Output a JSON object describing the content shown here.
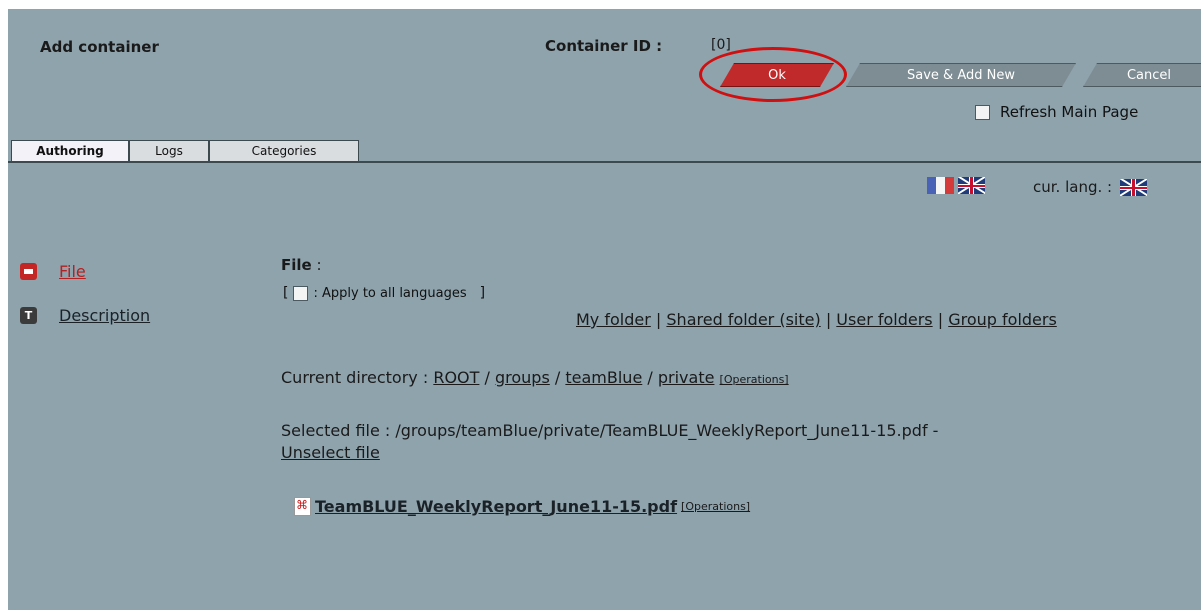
{
  "header": {
    "title": "Add container",
    "container_id_label": "Container ID :",
    "container_id_value": "[0]"
  },
  "buttons": {
    "ok": "Ok",
    "save_add_new": "Save & Add New",
    "cancel": "Cancel"
  },
  "refresh_label": "Refresh Main Page",
  "tabs": [
    {
      "label": "Authoring"
    },
    {
      "label": "Logs"
    },
    {
      "label": "Categories"
    }
  ],
  "lang": {
    "current_label": "cur. lang. :",
    "flags": [
      "flag-fr-icon",
      "flag-uk-icon"
    ]
  },
  "sidebar": [
    {
      "label": "File",
      "icon": "file-field-icon"
    },
    {
      "label": "Description",
      "icon": "text-field-icon"
    }
  ],
  "main": {
    "file_label": "File",
    "file_colon": ":",
    "apply_all_open": "[",
    "apply_all_label": ": Apply to all languages",
    "apply_all_close": "]",
    "folders": {
      "my": "My folder",
      "shared": "Shared folder (site)",
      "user": "User folders",
      "group": "Group folders",
      "sep": "|"
    },
    "current_dir_label": "Current directory :",
    "path": {
      "root": "ROOT",
      "groups": "groups",
      "team": "teamBlue",
      "private": "private",
      "sep": "/"
    },
    "operations": "[Operations]",
    "selected_file_label": "Selected file : /groups/teamBlue/private/TeamBLUE_WeeklyReport_June11-15.pdf -",
    "unselect": "Unselect file",
    "file_name": "TeamBLUE_WeeklyReport_June11-15.pdf"
  },
  "colors": {
    "panel": "#8fa3ad",
    "ok_button": "#c12a2a",
    "highlight": "#d01010",
    "grey_button": "#7e8d93"
  }
}
